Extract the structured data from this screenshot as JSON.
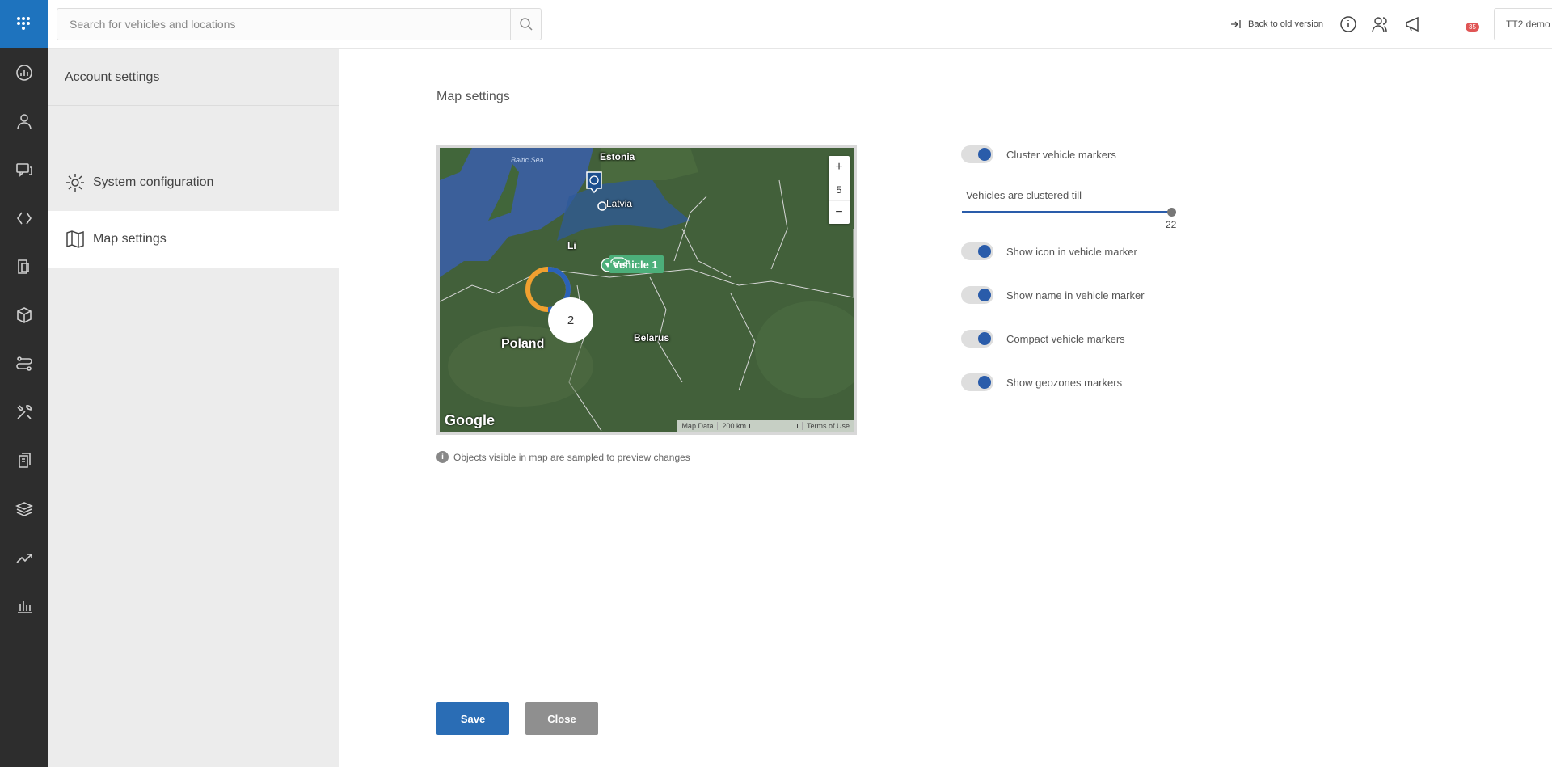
{
  "search": {
    "placeholder": "Search for vehicles and locations"
  },
  "header": {
    "back_label": "Back to old version",
    "notification_count": "35",
    "account_name": "TT2 demo"
  },
  "sidebar": {
    "title": "Account settings",
    "items": [
      {
        "label": "System configuration",
        "icon": "gear-icon"
      },
      {
        "label": "Map settings",
        "icon": "map-icon"
      }
    ]
  },
  "main": {
    "title": "Map settings",
    "map": {
      "labels": {
        "estonia": "Estonia",
        "latvia": "Latvia",
        "lithuania": "Li",
        "poland": "Poland",
        "belarus": "Belarus",
        "sea": "Baltic Sea"
      },
      "zoom_in": "+",
      "zoom_level": "5",
      "zoom_out": "−",
      "vehicle_label": "Vehicle 1",
      "cluster_count": "2",
      "google": "Google",
      "attrib": {
        "data": "Map Data",
        "scale": "200 km",
        "terms": "Terms of Use"
      }
    },
    "note": "Objects visible in map are sampled to preview changes"
  },
  "settings": {
    "cluster": {
      "label": "Cluster vehicle markers",
      "on": true
    },
    "cluster_till": {
      "label": "Vehicles are clustered till",
      "value": "22"
    },
    "show_icon": {
      "label": "Show icon in vehicle marker",
      "on": true
    },
    "show_name": {
      "label": "Show name in vehicle marker",
      "on": true
    },
    "compact": {
      "label": "Compact vehicle markers",
      "on": true
    },
    "geozones": {
      "label": "Show geozones markers",
      "on": true
    }
  },
  "buttons": {
    "save": "Save",
    "close": "Close"
  },
  "colors": {
    "brand": "#1e73be",
    "accent": "#2a5caa",
    "sidebar": "#2d2d2d",
    "vehicle": "#4caf7a",
    "badge": "#e05555"
  }
}
